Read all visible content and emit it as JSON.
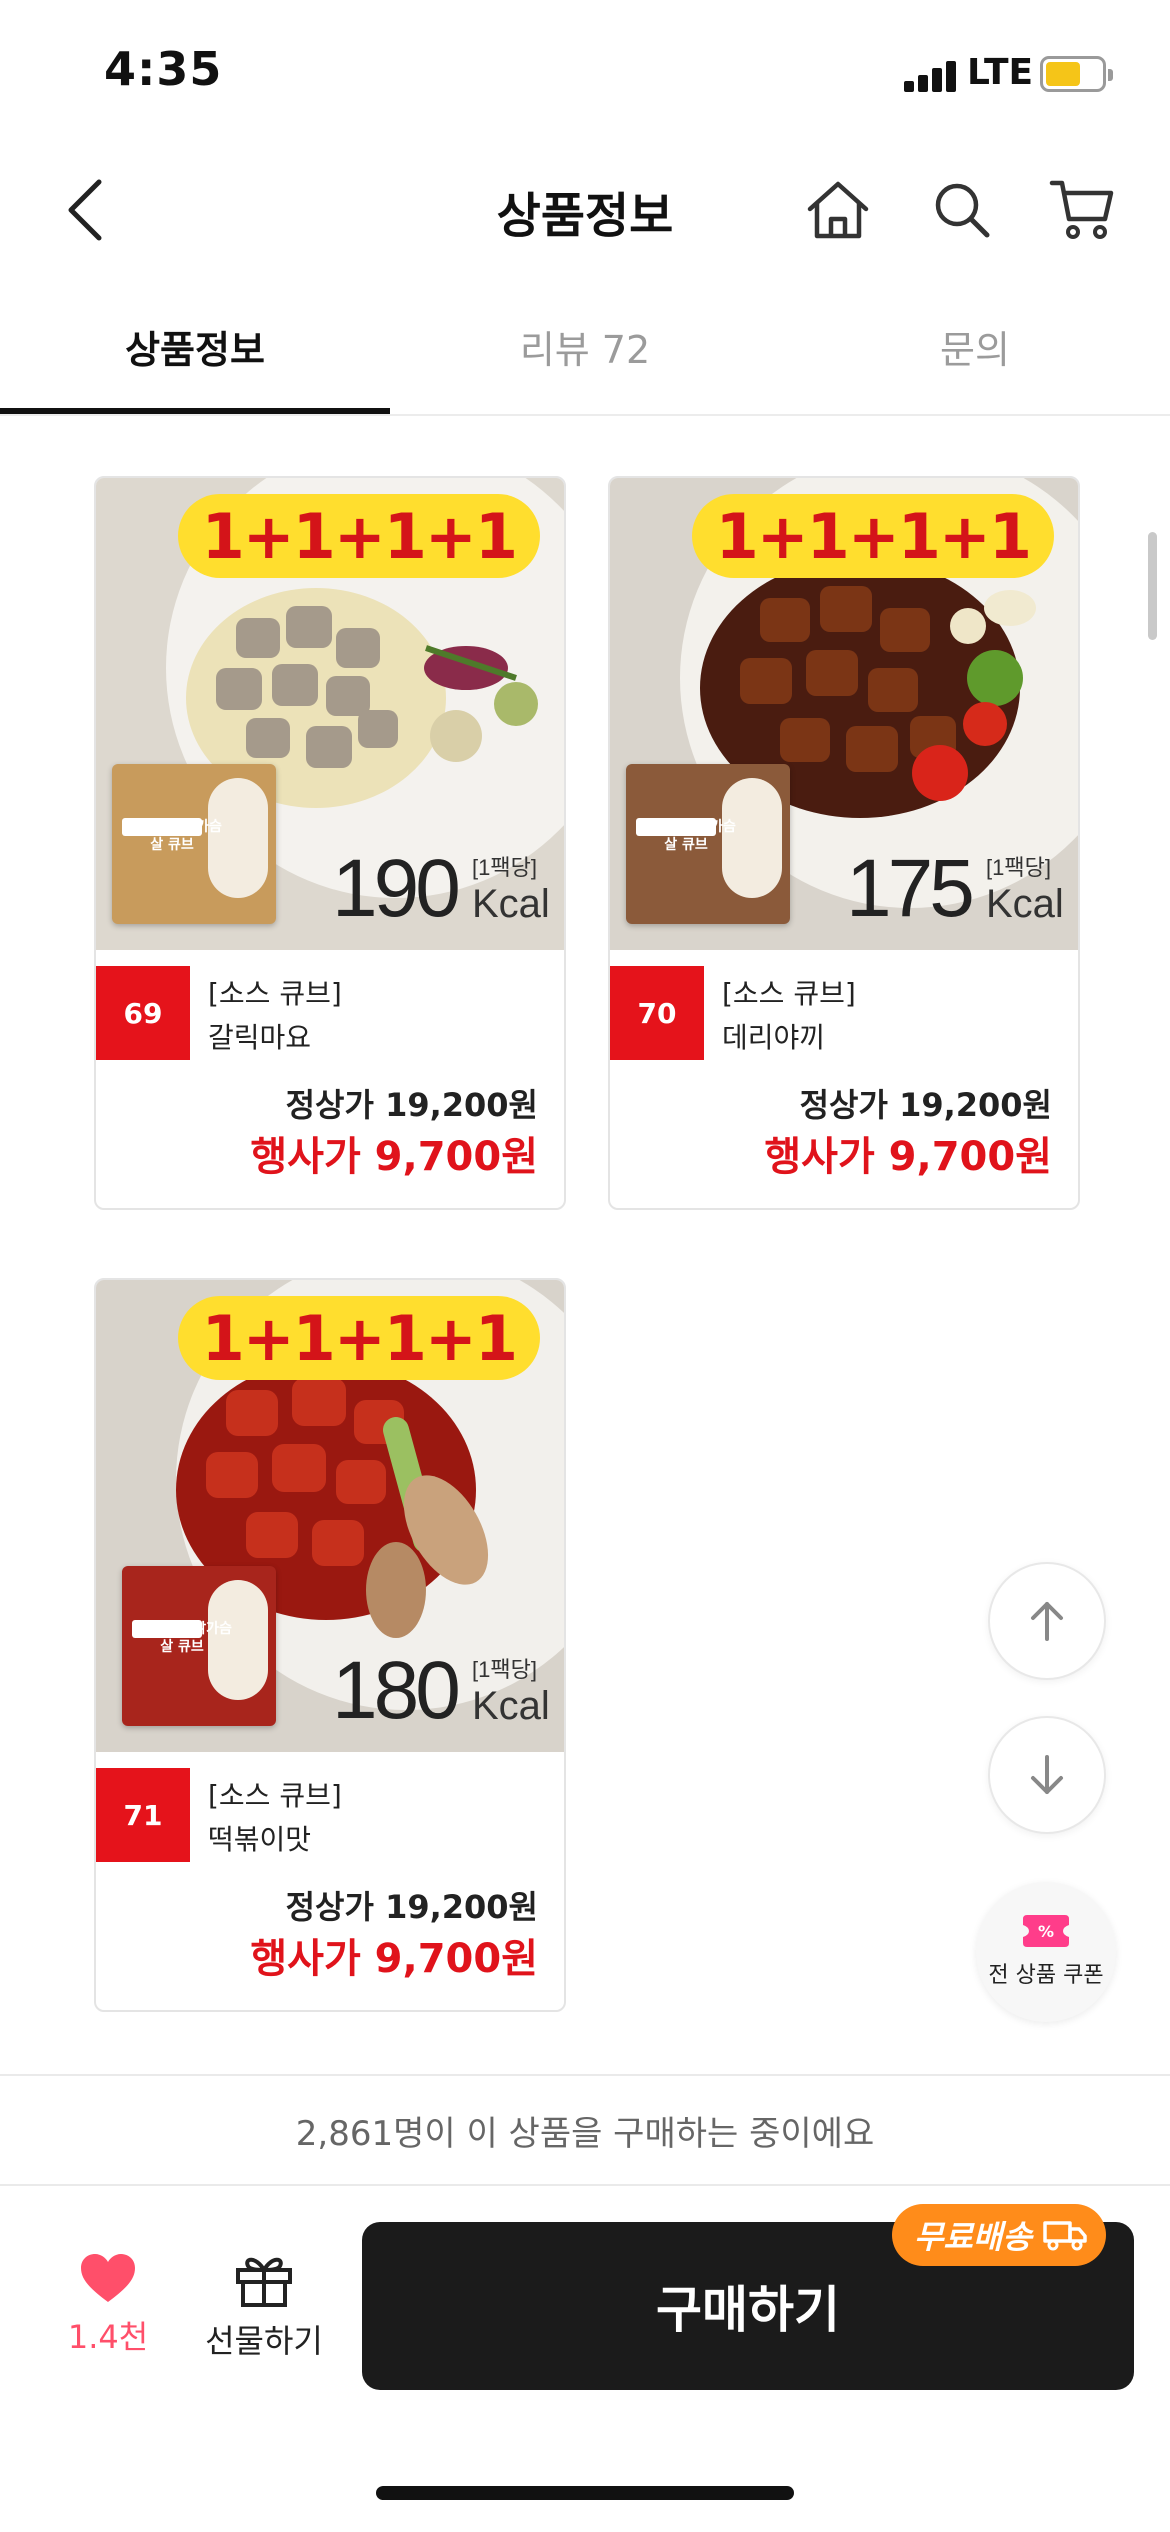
{
  "status_bar": {
    "time": "4:35",
    "network": "LTE"
  },
  "header": {
    "title": "상품정보"
  },
  "tabs": [
    {
      "label": "상품정보",
      "active": true
    },
    {
      "label": "리뷰 72",
      "active": false
    },
    {
      "label": "문의",
      "active": false
    }
  ],
  "products": [
    {
      "promo": "1+1+1+1",
      "kcal": "190",
      "kcal_pack": "[1팩당]",
      "kcal_unit": "Kcal",
      "number": "69",
      "category": "[소스 큐브]",
      "name": "갈릭마요",
      "regular_price": "정상가 19,200원",
      "sale_price": "행사가 9,700원",
      "pack_title": "소스 품은 닭가슴살 큐브"
    },
    {
      "promo": "1+1+1+1",
      "kcal": "175",
      "kcal_pack": "[1팩당]",
      "kcal_unit": "Kcal",
      "number": "70",
      "category": "[소스 큐브]",
      "name": "데리야끼",
      "regular_price": "정상가 19,200원",
      "sale_price": "행사가 9,700원",
      "pack_title": "소스 품은 닭가슴살 큐브"
    },
    {
      "promo": "1+1+1+1",
      "kcal": "180",
      "kcal_pack": "[1팩당]",
      "kcal_unit": "Kcal",
      "number": "71",
      "category": "[소스 큐브]",
      "name": "떡볶이맛",
      "regular_price": "정상가 19,200원",
      "sale_price": "행사가 9,700원",
      "pack_title": "소스 품은 닭가슴살 큐브"
    }
  ],
  "coupon": {
    "label": "전 상품 쿠폰"
  },
  "buyers_notice": "2,861명이 이 상품을 구매하는 중이에요",
  "bottom": {
    "like_count": "1.4천",
    "gift_label": "선물하기",
    "buy_label": "구매하기",
    "free_shipping": "무료배송"
  },
  "colors": {
    "accent_red": "#e5131b",
    "sale_red": "#e0131b",
    "promo_yellow": "#ffde2e",
    "free_ship_orange": "#ff8c1a",
    "like_pink": "#ff4f6a"
  }
}
